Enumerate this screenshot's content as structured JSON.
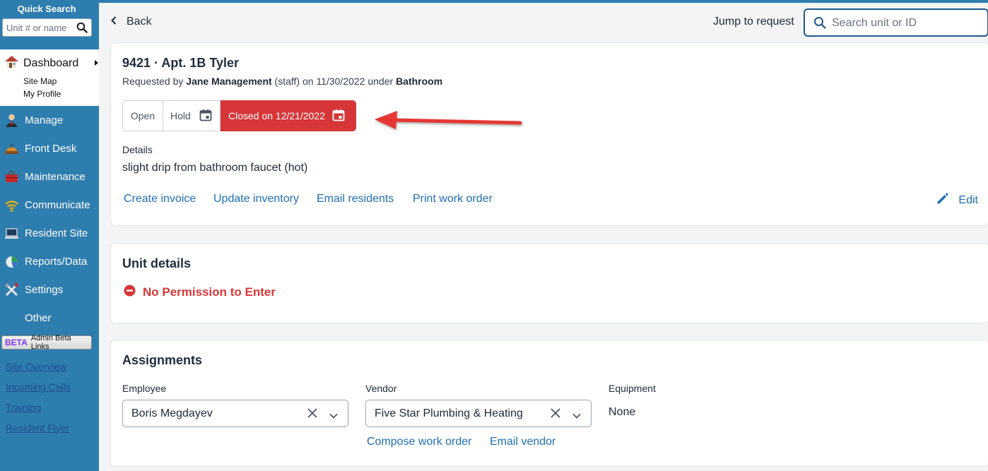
{
  "sidebar": {
    "quick_search_title": "Quick Search",
    "quick_search_placeholder": "Unit # or name",
    "dashboard_label": "Dashboard",
    "dashboard_sub": [
      "Site Map",
      "My Profile"
    ],
    "nav": [
      "Manage",
      "Front Desk",
      "Maintenance",
      "Communicate",
      "Resident Site",
      "Reports/Data",
      "Settings",
      "Other"
    ],
    "beta_tag": "BETA",
    "beta_label": "Admin Beta Links",
    "links": [
      "Site Overview",
      "Incoming Calls",
      "Training",
      "Resident Flyer"
    ]
  },
  "header": {
    "back_label": "Back",
    "jump_label": "Jump to request",
    "search_placeholder": "Search unit or ID"
  },
  "request": {
    "title": "9421 · Apt. 1B Tyler",
    "sub_prefix": "Requested by ",
    "requester": "Jane Management",
    "sub_middle": " (staff) on 11/30/2022 under ",
    "category": "Bathroom",
    "status": {
      "open": "Open",
      "hold": "Hold",
      "closed": "Closed on 12/21/2022"
    },
    "details_label": "Details",
    "details_text": "slight drip from bathroom faucet (hot)",
    "actions": [
      "Create invoice",
      "Update inventory",
      "Email residents",
      "Print work order"
    ],
    "edit_label": "Edit"
  },
  "unit_details": {
    "title": "Unit details",
    "permission": "No Permission to Enter"
  },
  "assignments": {
    "title": "Assignments",
    "employee_label": "Employee",
    "employee_value": "Boris Megdayev",
    "vendor_label": "Vendor",
    "vendor_value": "Five Star Plumbing & Heating",
    "equipment_label": "Equipment",
    "equipment_value": "None",
    "vendor_actions": [
      "Compose work order",
      "Email vendor"
    ]
  },
  "colors": {
    "sidebar": "#2e7daf",
    "closed_status": "#d63638",
    "link": "#1e6fb5",
    "annotation_arrow": "#e53935"
  }
}
